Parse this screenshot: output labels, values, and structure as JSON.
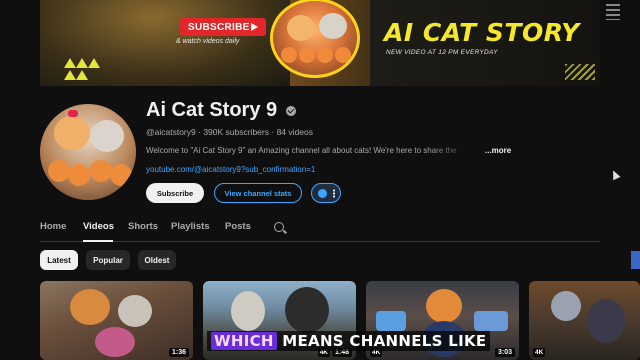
{
  "banner": {
    "subscribe_badge": "SUBSCRIBE",
    "watch_daily": "& watch videos daily",
    "title": "AI CAT STORY",
    "subtitle": "NEW VIDEO AT 12 PM EVERYDAY"
  },
  "channel": {
    "name": "Ai Cat Story 9",
    "handle": "@aicatstory9",
    "subscribers": "390K subscribers",
    "videos": "84 videos",
    "description": "Welcome to \"Ai Cat Story 9\" an Amazing channel all about cats! We're here to share the",
    "more": "...more",
    "link": "youtube.com/@aicatstory9?sub_confirmation=1"
  },
  "buttons": {
    "subscribe": "Subscribe",
    "view_stats": "View channel stats"
  },
  "tabs": [
    {
      "label": "Home",
      "active": false
    },
    {
      "label": "Videos",
      "active": true
    },
    {
      "label": "Shorts",
      "active": false
    },
    {
      "label": "Playlists",
      "active": false
    },
    {
      "label": "Posts",
      "active": false
    }
  ],
  "filters": [
    {
      "label": "Latest",
      "active": true
    },
    {
      "label": "Popular",
      "active": false
    },
    {
      "label": "Oldest",
      "active": false
    }
  ],
  "videos": [
    {
      "duration": "1:36",
      "badge": ""
    },
    {
      "duration": "1:48",
      "badge": "4K"
    },
    {
      "duration": "3:03",
      "badge": "4K"
    },
    {
      "duration": "",
      "badge": "4K"
    }
  ],
  "caption": {
    "highlight": "WHICH",
    "rest": " MEANS CHANNELS LIKE"
  },
  "icons": {
    "verified": "verified-check-icon",
    "search": "search-icon",
    "more_options": "three-dots-icon",
    "cursor": "mouse-cursor-icon"
  },
  "colors": {
    "background": "#0f0f0f",
    "link": "#3ea6ff",
    "banner_title": "#f5e82a",
    "subscribe_badge": "#e3262a"
  }
}
